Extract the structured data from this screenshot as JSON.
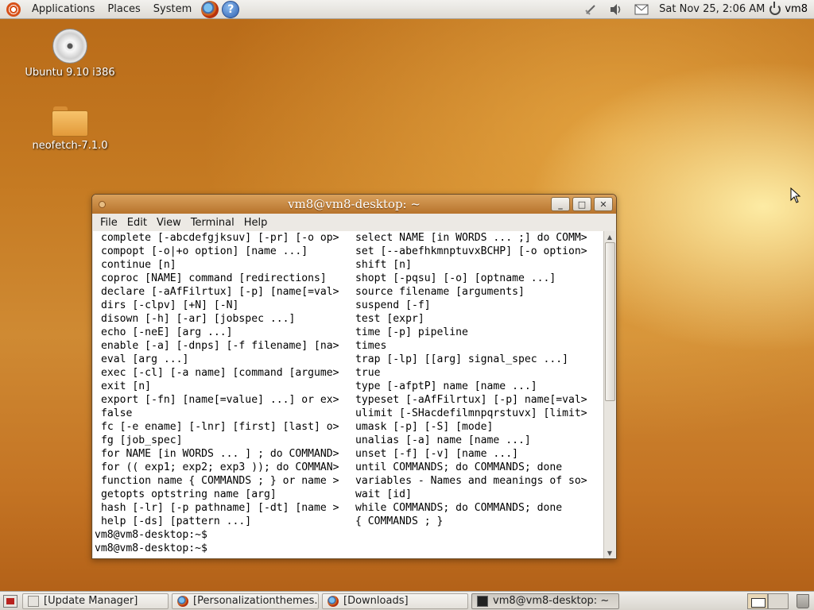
{
  "top_panel": {
    "menus": [
      "Applications",
      "Places",
      "System"
    ],
    "help_glyph": "?",
    "clock": "Sat Nov 25,  2:06 AM",
    "user": "vm8",
    "tray_icons": [
      "network-icon",
      "volume-icon",
      "mail-icon"
    ]
  },
  "desktop": {
    "icons": [
      {
        "label": "Ubuntu 9.10 i386",
        "icon": "cd-icon"
      },
      {
        "label": "neofetch-7.1.0",
        "icon": "folder-icon"
      }
    ]
  },
  "terminal": {
    "title": "vm8@vm8-desktop: ~",
    "menu": [
      "File",
      "Edit",
      "View",
      "Terminal",
      "Help"
    ],
    "buttons": {
      "minimize": "_",
      "maximize": "□",
      "close": "✕"
    },
    "rows": [
      [
        "complete [-abcdefgjksuv] [-pr] [-o op>",
        "select NAME [in WORDS ... ;] do COMM>"
      ],
      [
        "compopt [-o|+o option] [name ...]",
        "set [--abefhkmnptuvxBCHP] [-o option>"
      ],
      [
        "continue [n]",
        "shift [n]"
      ],
      [
        "coproc [NAME] command [redirections]",
        "shopt [-pqsu] [-o] [optname ...]"
      ],
      [
        "declare [-aAfFilrtux] [-p] [name[=val>",
        "source filename [arguments]"
      ],
      [
        "dirs [-clpv] [+N] [-N]",
        "suspend [-f]"
      ],
      [
        "disown [-h] [-ar] [jobspec ...]",
        "test [expr]"
      ],
      [
        "echo [-neE] [arg ...]",
        "time [-p] pipeline"
      ],
      [
        "enable [-a] [-dnps] [-f filename] [na>",
        "times"
      ],
      [
        "eval [arg ...]",
        "trap [-lp] [[arg] signal_spec ...]"
      ],
      [
        "exec [-cl] [-a name] [command [argume>",
        "true"
      ],
      [
        "exit [n]",
        "type [-afptP] name [name ...]"
      ],
      [
        "export [-fn] [name[=value] ...] or ex>",
        "typeset [-aAfFilrtux] [-p] name[=val>"
      ],
      [
        "false",
        "ulimit [-SHacdefilmnpqrstuvx] [limit>"
      ],
      [
        "fc [-e ename] [-lnr] [first] [last] o>",
        "umask [-p] [-S] [mode]"
      ],
      [
        "fg [job_spec]",
        "unalias [-a] name [name ...]"
      ],
      [
        "for NAME [in WORDS ... ] ; do COMMAND>",
        "unset [-f] [-v] [name ...]"
      ],
      [
        "for (( exp1; exp2; exp3 )); do COMMAN>",
        "until COMMANDS; do COMMANDS; done"
      ],
      [
        "function name { COMMANDS ; } or name >",
        "variables - Names and meanings of so>"
      ],
      [
        "getopts optstring name [arg]",
        "wait [id]"
      ],
      [
        "hash [-lr] [-p pathname] [-dt] [name >",
        "while COMMANDS; do COMMANDS; done"
      ],
      [
        "help [-ds] [pattern ...]",
        "{ COMMANDS ; }"
      ]
    ],
    "prompts": [
      "vm8@vm8-desktop:~$",
      "vm8@vm8-desktop:~$"
    ]
  },
  "taskbar": {
    "tasks": [
      {
        "label": "[Update Manager]",
        "icon": "update-manager-icon"
      },
      {
        "label": "[Personalizationthemes...",
        "icon": "firefox-icon"
      },
      {
        "label": "[Downloads]",
        "icon": "firefox-icon"
      },
      {
        "label": "vm8@vm8-desktop: ~",
        "icon": "terminal-icon",
        "active": true
      }
    ]
  },
  "colors": {
    "titlebar": "#c98a45",
    "desktop_base": "#c57a22",
    "accent": "#d75019"
  }
}
